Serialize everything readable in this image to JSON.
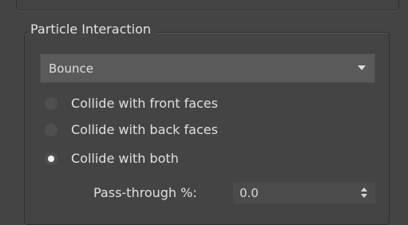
{
  "group": {
    "title": "Particle Interaction"
  },
  "dropdown": {
    "selected": "Bounce"
  },
  "radios": [
    {
      "label": "Collide with front faces",
      "checked": false
    },
    {
      "label": "Collide with back faces",
      "checked": false
    },
    {
      "label": "Collide with both",
      "checked": true
    }
  ],
  "pass_through": {
    "label": "Pass-through %:",
    "value": "0.0"
  },
  "colors": {
    "background": "#444444",
    "control": "#5a5a5a",
    "text": "#dcdcdc"
  }
}
